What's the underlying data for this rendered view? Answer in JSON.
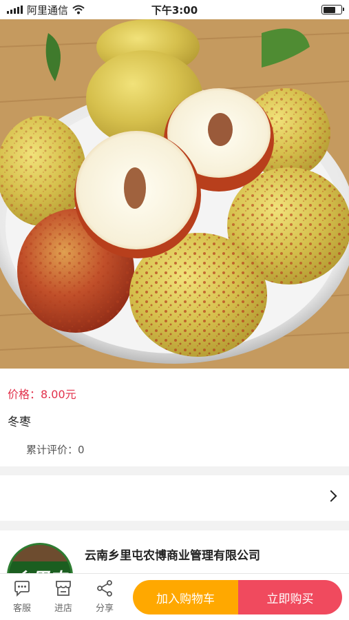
{
  "status_bar": {
    "carrier": "阿里通信",
    "time": "下午3:00",
    "battery_level": 0.7
  },
  "product": {
    "image_description_icon": "jujube-photo",
    "price_label": "价格：",
    "price_value": "8.00元",
    "name": "冬枣",
    "reviews_label": "累计评价：",
    "reviews_count": "0"
  },
  "spec_row": {
    "chevron_icon": "chevron-right-icon"
  },
  "shop": {
    "name": "云南乡里屯农博商业管理有限公司",
    "avatar_text": "乡里屯"
  },
  "bottom_bar": {
    "customer_service": "客服",
    "enter_shop": "进店",
    "share": "分享",
    "add_to_cart": "加入购物车",
    "buy_now": "立即购买"
  },
  "colors": {
    "price": "#e2314b",
    "cart_button": "#ffa800",
    "buy_button": "#f04a5e"
  }
}
